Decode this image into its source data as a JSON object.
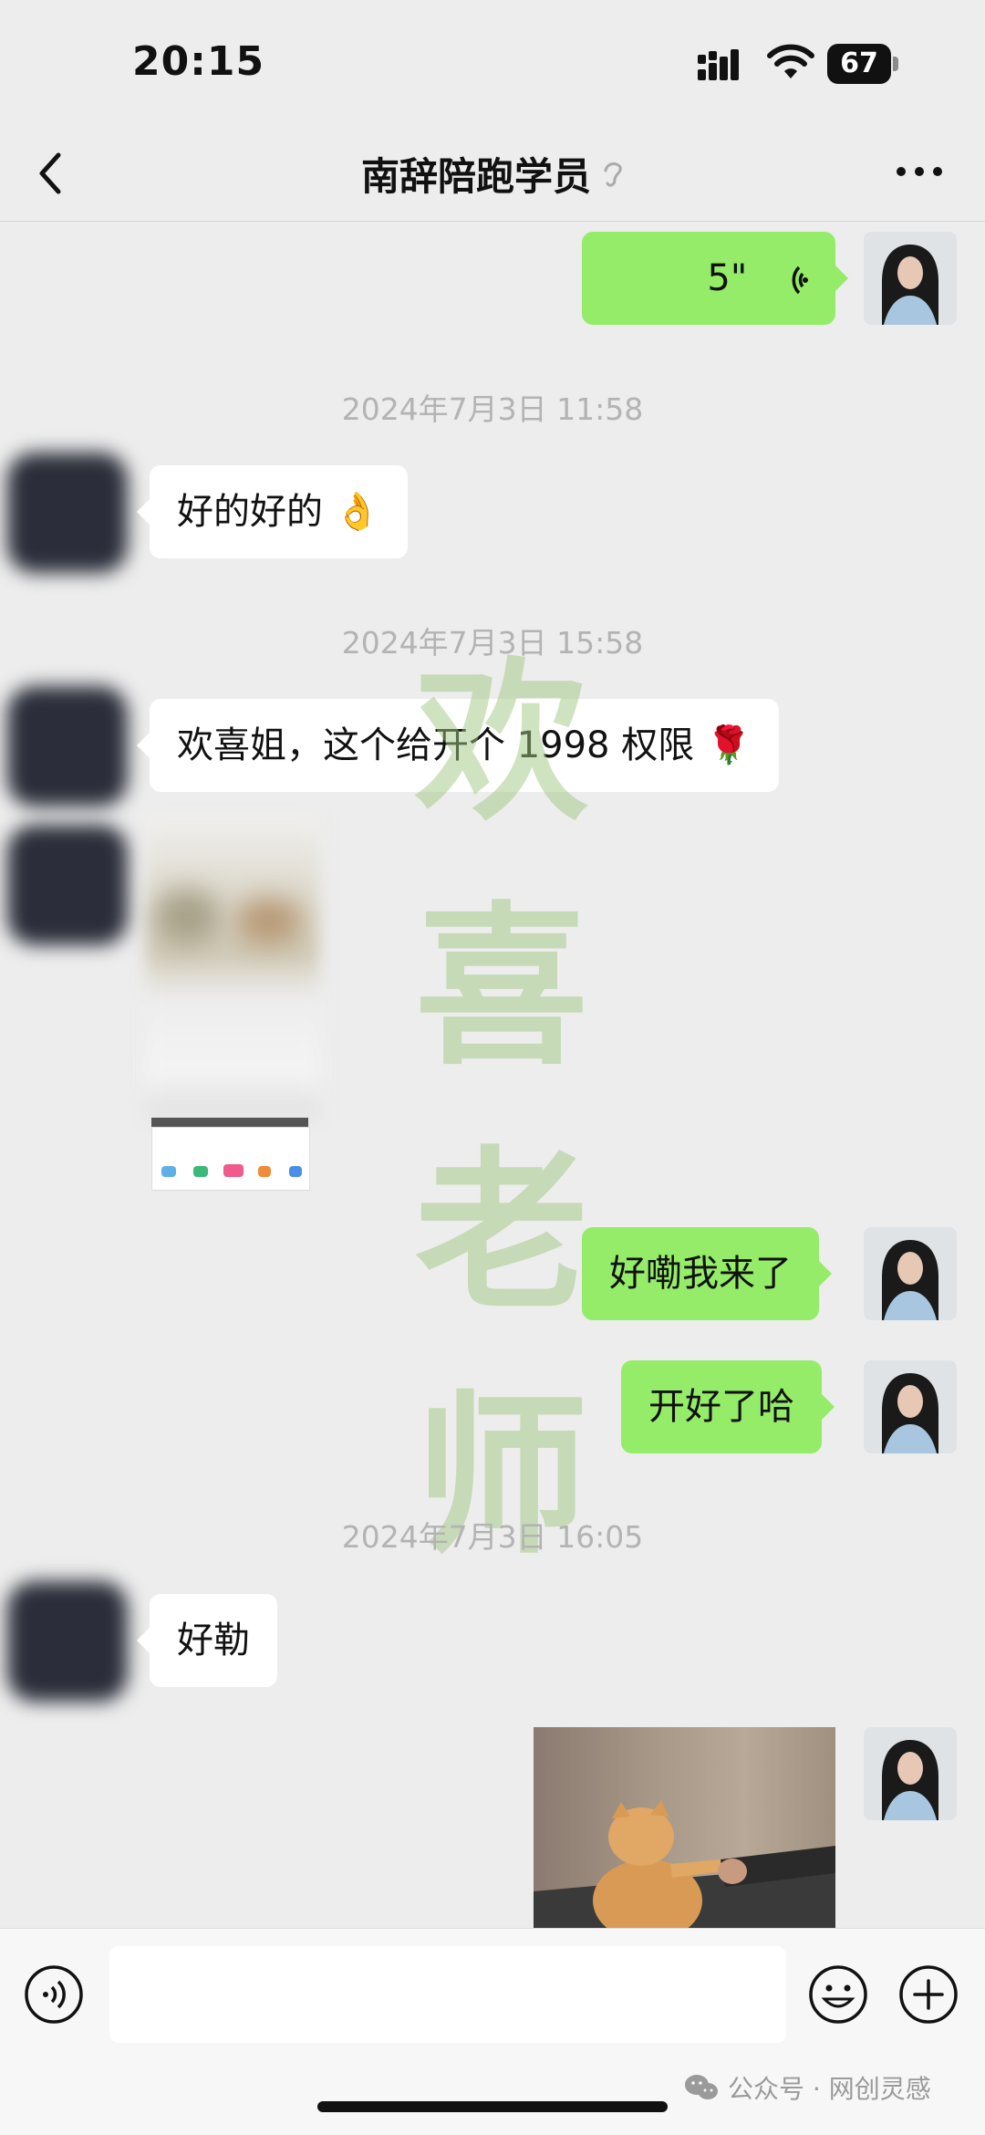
{
  "status_bar": {
    "time": "20:15",
    "battery": "67"
  },
  "header": {
    "title": "南辞陪跑学员"
  },
  "messages": {
    "voice_duration": "5\"",
    "ts1": "2024年7月3日 11:58",
    "m1_text": "好的好的",
    "m1_emoji": "👌",
    "ts2": "2024年7月3日 15:58",
    "m2_text": "欢喜姐，这个给开个 1998 权限",
    "m2_emoji": "🌹",
    "m3_text": "好嘞我来了",
    "m4_text": "开好了哈",
    "ts3": "2024年7月3日 16:05",
    "m5_text": "好勒"
  },
  "watermark": {
    "chars": [
      "欢",
      "喜",
      "老",
      "师"
    ]
  },
  "footer": {
    "tag": "公众号 · 网创灵感"
  },
  "colors": {
    "background": "#ededed",
    "incoming_bubble": "#ffffff",
    "outgoing_bubble": "#95ec69"
  }
}
